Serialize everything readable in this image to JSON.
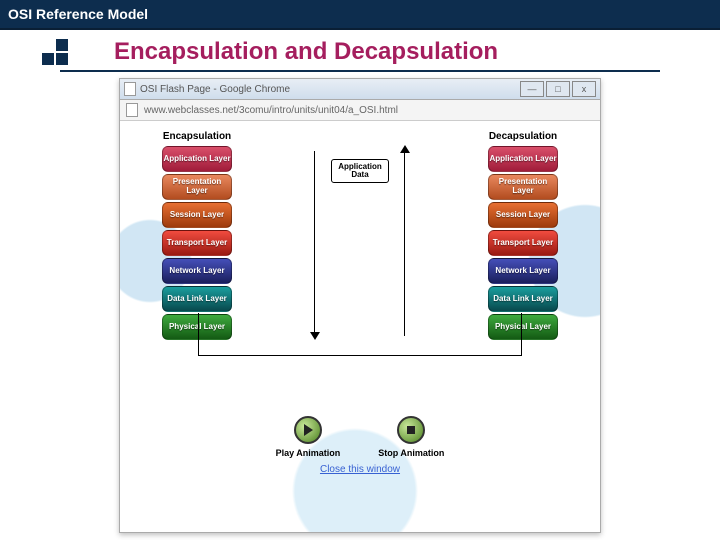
{
  "header": {
    "title": "OSI Reference Model"
  },
  "slide": {
    "title": "Encapsulation and Decapsulation"
  },
  "browser": {
    "tab_title": "OSI Flash Page - Google Chrome",
    "url": "www.webclasses.net/3comu/intro/units/unit04/a_OSI.html",
    "min": "—",
    "max": "□",
    "close": "x"
  },
  "diagram": {
    "left_title": "Encapsulation",
    "right_title": "Decapsulation",
    "data_box": "Application Data",
    "layers": [
      {
        "label": "Application Layer",
        "cls": "c-app"
      },
      {
        "label": "Presentation Layer",
        "cls": "c-pre"
      },
      {
        "label": "Session Layer",
        "cls": "c-ses"
      },
      {
        "label": "Transport Layer",
        "cls": "c-tra"
      },
      {
        "label": "Network Layer",
        "cls": "c-net"
      },
      {
        "label": "Data Link Layer",
        "cls": "c-dat"
      },
      {
        "label": "Physical Layer",
        "cls": "c-phy"
      }
    ]
  },
  "controls": {
    "play": "Play Animation",
    "stop": "Stop Animation",
    "close_link": "Close this window"
  }
}
